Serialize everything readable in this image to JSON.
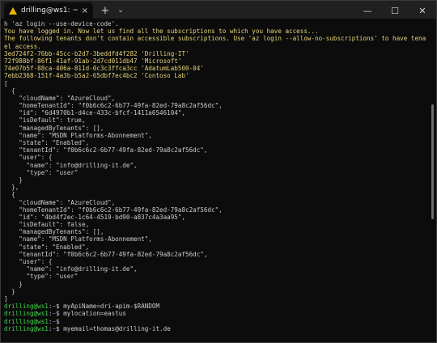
{
  "window": {
    "tab_title": "drilling@ws1: ~",
    "tab_close": "×",
    "new_tab": "+",
    "dropdown": "⌄",
    "minimize": "—",
    "maximize": "☐",
    "close": "✕"
  },
  "terminal": {
    "lines": [
      {
        "color": "white",
        "text": "h 'az login --use-device-code'."
      },
      {
        "color": "yellow",
        "text": "You have logged in. Now let us find all the subscriptions to which you have access..."
      },
      {
        "color": "yellow",
        "text": "The following tenants don't contain accessible subscriptions. Use 'az login --allow-no-subscriptions' to have tenant lev"
      },
      {
        "color": "yellow",
        "text": "el access."
      },
      {
        "color": "yellow",
        "text": "3ed724f2-76bb-45cc-b2d7-3beddfd4f282 'Drilling-IT'"
      },
      {
        "color": "yellow",
        "text": "72f988bf-86f1-41af-91ab-2d7cd011db47 'Microsoft'"
      },
      {
        "color": "yellow",
        "text": "74e07b5f-88ca-406a-811d-0c3c3ffca3cc 'AdatumLab500-04'"
      },
      {
        "color": "yellow",
        "text": "7ebb2368-151f-4a3b-b5a2-65dbf7ec4bc2 'Contoso Lab'"
      },
      {
        "color": "white",
        "text": "["
      },
      {
        "color": "white",
        "text": "  {"
      },
      {
        "color": "white",
        "text": "    \"cloudName\": \"AzureCloud\","
      },
      {
        "color": "white",
        "text": "    \"homeTenantId\": \"f0b6c6c2-6b77-49fa-82ed-79a8c2af56dc\","
      },
      {
        "color": "white",
        "text": "    \"id\": \"6d4970b1-d4ce-433c-bfcf-1411a6546104\","
      },
      {
        "color": "white",
        "text": "    \"isDefault\": true,"
      },
      {
        "color": "white",
        "text": "    \"managedByTenants\": [],"
      },
      {
        "color": "white",
        "text": "    \"name\": \"MSDN Platforms-Abonnement\","
      },
      {
        "color": "white",
        "text": "    \"state\": \"Enabled\","
      },
      {
        "color": "white",
        "text": "    \"tenantId\": \"f0b6c6c2-6b77-49fa-82ed-79a8c2af56dc\","
      },
      {
        "color": "white",
        "text": "    \"user\": {"
      },
      {
        "color": "white",
        "text": "      \"name\": \"info@drilling-it.de\","
      },
      {
        "color": "white",
        "text": "      \"type\": \"user\""
      },
      {
        "color": "white",
        "text": "    }"
      },
      {
        "color": "white",
        "text": "  },"
      },
      {
        "color": "white",
        "text": "  {"
      },
      {
        "color": "white",
        "text": "    \"cloudName\": \"AzureCloud\","
      },
      {
        "color": "white",
        "text": "    \"homeTenantId\": \"f0b6c6c2-6b77-49fa-82ed-79a8c2af56dc\","
      },
      {
        "color": "white",
        "text": "    \"id\": \"4bd4f2ec-1c64-4519-bd90-a837c4a3aa95\","
      },
      {
        "color": "white",
        "text": "    \"isDefault\": false,"
      },
      {
        "color": "white",
        "text": "    \"managedByTenants\": [],"
      },
      {
        "color": "white",
        "text": "    \"name\": \"MSDN Platforms-Abonnement\","
      },
      {
        "color": "white",
        "text": "    \"state\": \"Enabled\","
      },
      {
        "color": "white",
        "text": "    \"tenantId\": \"f0b6c6c2-6b77-49fa-82ed-79a8c2af56dc\","
      },
      {
        "color": "white",
        "text": "    \"user\": {"
      },
      {
        "color": "white",
        "text": "      \"name\": \"info@drilling-it.de\","
      },
      {
        "color": "white",
        "text": "      \"type\": \"user\""
      },
      {
        "color": "white",
        "text": "    }"
      },
      {
        "color": "white",
        "text": "  }"
      },
      {
        "color": "white",
        "text": "]"
      }
    ],
    "prompts": [
      {
        "user": "drilling@ws1",
        "sep": ":",
        "path": "~",
        "sym": "$ ",
        "cmd": "myApiName=dri-apim-$RANDOM"
      },
      {
        "user": "drilling@ws1",
        "sep": ":",
        "path": "~",
        "sym": "$ ",
        "cmd": "mylocation=eastus"
      },
      {
        "user": "drilling@ws1",
        "sep": ":",
        "path": "~",
        "sym": "$ ",
        "cmd": ""
      },
      {
        "user": "drilling@ws1",
        "sep": ":",
        "path": "~",
        "sym": "$ ",
        "cmd": "myemail=thomas@drilling-it.de"
      }
    ]
  },
  "colors": {
    "background": "#0c0c0c",
    "output_yellow": "#e5d27a",
    "prompt_green": "#3fd64a",
    "path_blue": "#4a87ff",
    "text_white": "#cccccc"
  }
}
